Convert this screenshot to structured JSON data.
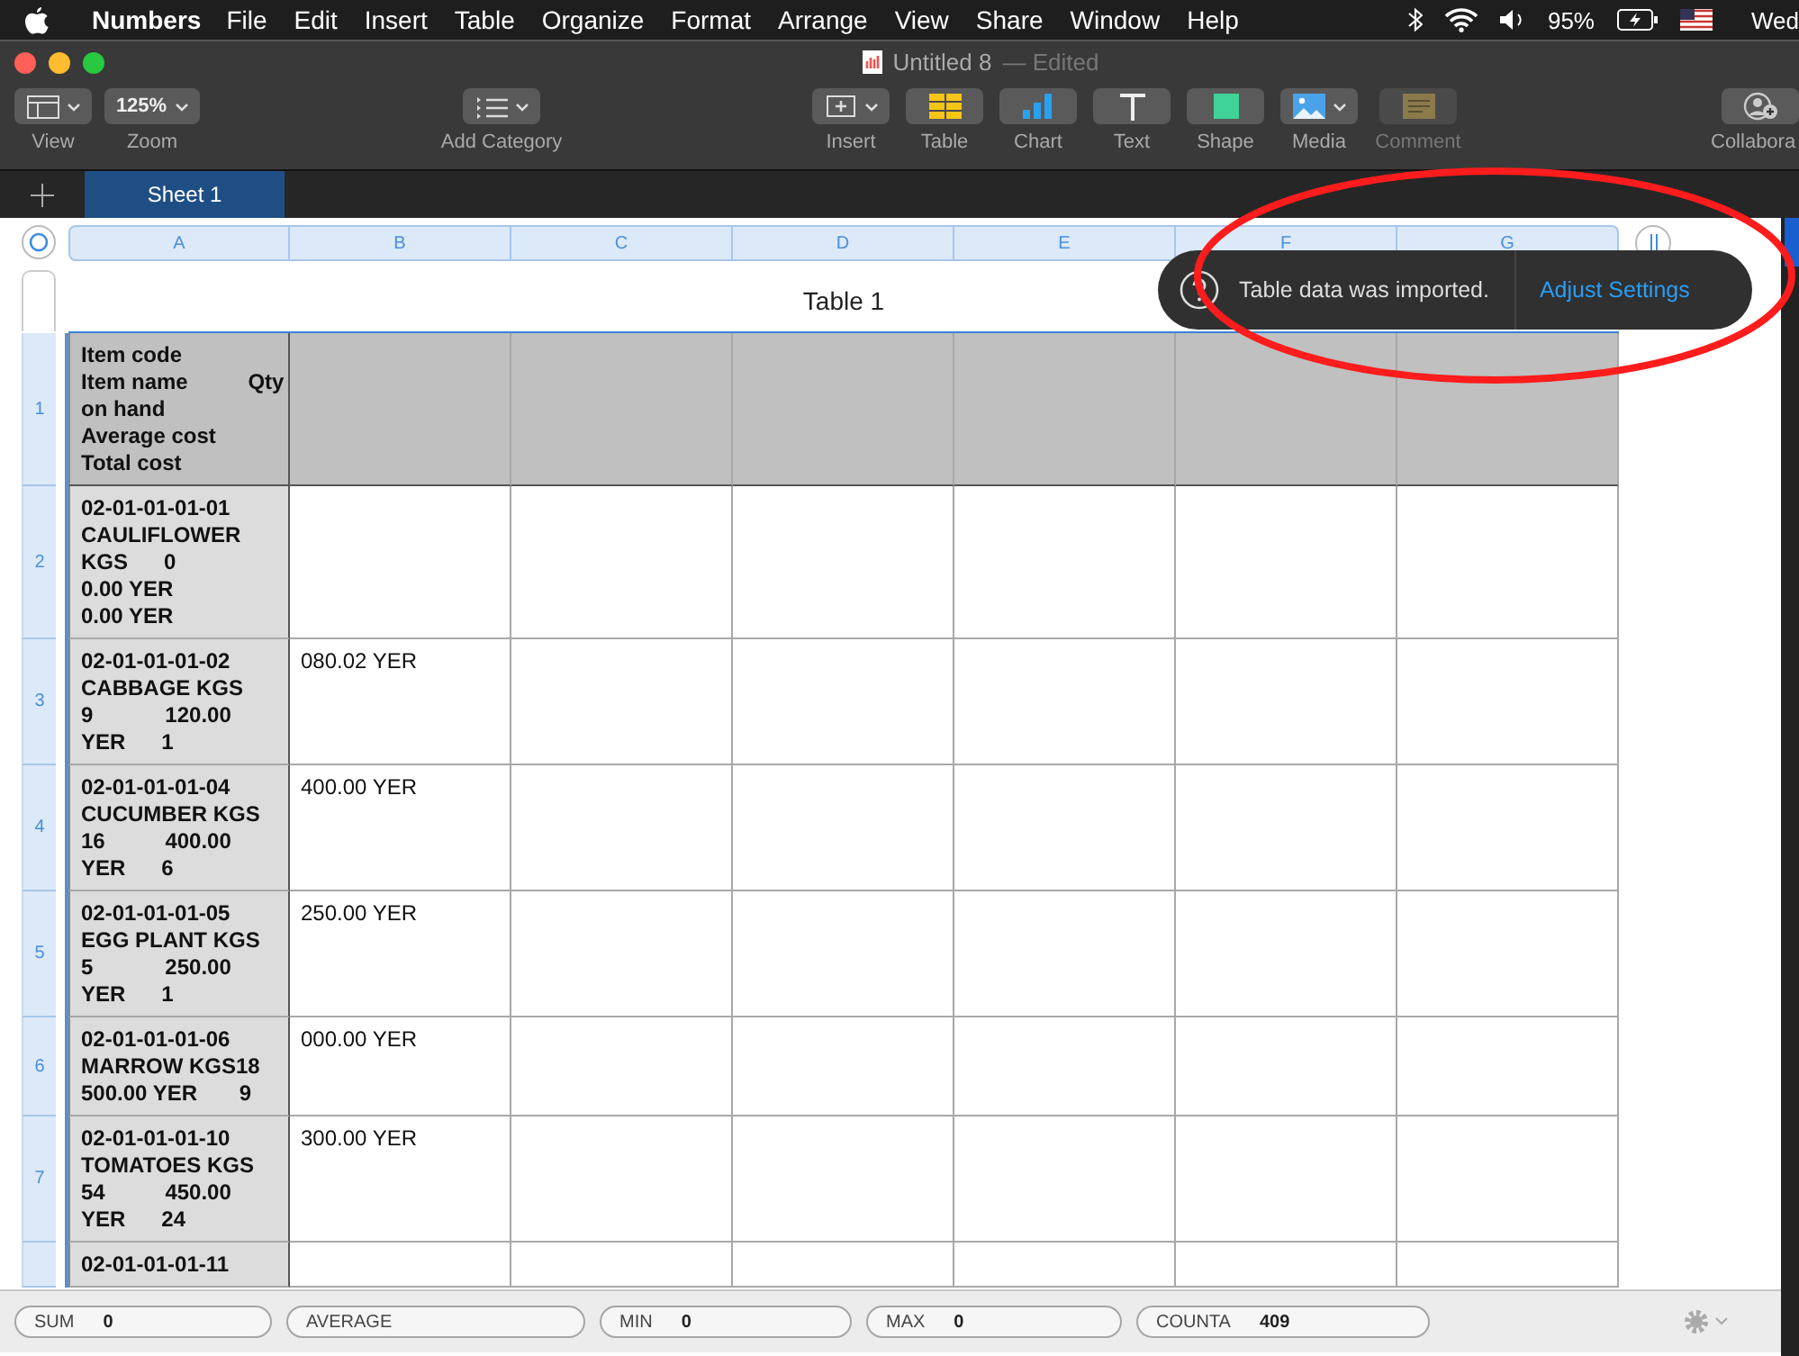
{
  "menu_bar": {
    "app": "Numbers",
    "items": [
      "File",
      "Edit",
      "Insert",
      "Table",
      "Organize",
      "Format",
      "Arrange",
      "View",
      "Share",
      "Window",
      "Help"
    ],
    "battery": "95%",
    "day": "Wed"
  },
  "window": {
    "title": "Untitled 8",
    "status": "— Edited"
  },
  "toolbar": {
    "left": [
      {
        "kind": "view",
        "label": "View",
        "menu": true
      },
      {
        "kind": "zoom",
        "label": "Zoom",
        "value": "125%",
        "menu": true
      }
    ],
    "category": {
      "kind": "category",
      "label": "Add Category",
      "menu": true
    },
    "center": [
      {
        "kind": "insert",
        "label": "Insert",
        "menu": true,
        "disabled": false
      },
      {
        "kind": "table",
        "label": "Table",
        "disabled": false
      },
      {
        "kind": "chart",
        "label": "Chart",
        "disabled": false
      },
      {
        "kind": "text",
        "label": "Text",
        "disabled": false
      },
      {
        "kind": "shape",
        "label": "Shape",
        "disabled": false
      },
      {
        "kind": "media",
        "label": "Media",
        "menu": true,
        "disabled": false
      },
      {
        "kind": "comment",
        "label": "Comment",
        "disabled": true
      }
    ],
    "right": {
      "kind": "collaborate",
      "label": "Collabora"
    }
  },
  "sheets": [
    {
      "label": "Sheet 1",
      "selected": true
    }
  ],
  "table": {
    "title": "Table 1",
    "columns": [
      "A",
      "B",
      "C",
      "D",
      "E",
      "F",
      "G"
    ],
    "rows": [
      {
        "number": "1",
        "kind": "header",
        "cells": [
          "Item code\nItem name          Qty\non hand\nAverage cost\nTotal cost"
        ]
      },
      {
        "number": "2",
        "kind": "body",
        "cells": [
          "02-01-01-01-01\nCAULIFLOWER\nKGS      0\n0.00 YER\n0.00 YER"
        ]
      },
      {
        "number": "3",
        "kind": "body",
        "cells": [
          "02-01-01-01-02\nCABBAGE KGS\n9            120.00\nYER      1",
          "080.02 YER"
        ]
      },
      {
        "number": "4",
        "kind": "body",
        "cells": [
          "02-01-01-01-04\nCUCUMBER KGS\n16          400.00\nYER      6",
          "400.00 YER"
        ]
      },
      {
        "number": "5",
        "kind": "body",
        "cells": [
          "02-01-01-01-05\nEGG PLANT KGS\n5            250.00\nYER      1",
          "250.00 YER"
        ]
      },
      {
        "number": "6",
        "kind": "body",
        "cells": [
          "02-01-01-01-06\nMARROW KGS18\n500.00 YER       9",
          "000.00 YER"
        ]
      },
      {
        "number": "7",
        "kind": "body",
        "cells": [
          "02-01-01-01-10\nTOMATOES KGS\n54          450.00\nYER      24",
          "300.00 YER"
        ]
      },
      {
        "kind": "body",
        "cells": [
          "02-01-01-01-11"
        ]
      }
    ]
  },
  "notification": {
    "message": "Table data was imported.",
    "action": "Adjust Settings"
  },
  "status_bar": [
    {
      "label": "SUM",
      "value": "0"
    },
    {
      "label": "AVERAGE"
    },
    {
      "label": "MIN",
      "value": "0"
    },
    {
      "label": "MAX",
      "value": "0"
    },
    {
      "label": "COUNTA",
      "value": "409"
    }
  ]
}
